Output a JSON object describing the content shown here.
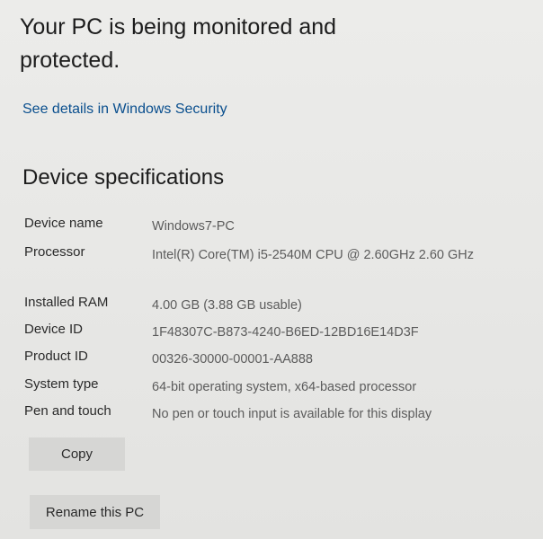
{
  "protection": {
    "status": "Your PC is being monitored and protected.",
    "link": "See details in Windows Security"
  },
  "device_specs": {
    "title": "Device specifications",
    "rows": [
      {
        "label": "Device name",
        "value": "Windows7-PC"
      },
      {
        "label": "Processor",
        "value": "Intel(R) Core(TM) i5-2540M CPU @ 2.60GHz   2.60 GHz"
      },
      {
        "label": "Installed RAM",
        "value": "4.00 GB (3.88 GB usable)"
      },
      {
        "label": "Device ID",
        "value": "1F48307C-B873-4240-B6ED-12BD16E14D3F"
      },
      {
        "label": "Product ID",
        "value": "00326-30000-00001-AA888"
      },
      {
        "label": "System type",
        "value": "64-bit operating system, x64-based processor"
      },
      {
        "label": "Pen and touch",
        "value": "No pen or touch input is available for this display"
      }
    ],
    "copy_label": "Copy"
  },
  "rename_label": "Rename this PC"
}
